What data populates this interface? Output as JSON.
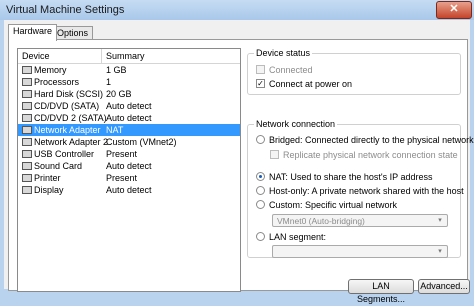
{
  "window": {
    "title": "Virtual Machine Settings",
    "close_glyph": "✕"
  },
  "tabs": [
    {
      "label": "Hardware"
    },
    {
      "label": "Options"
    }
  ],
  "device_list": {
    "col_device": "Device",
    "col_summary": "Summary",
    "rows": [
      {
        "device": "Memory",
        "summary": "1 GB"
      },
      {
        "device": "Processors",
        "summary": "1"
      },
      {
        "device": "Hard Disk (SCSI)",
        "summary": "20 GB"
      },
      {
        "device": "CD/DVD (SATA)",
        "summary": "Auto detect"
      },
      {
        "device": "CD/DVD 2 (SATA)",
        "summary": "Auto detect"
      },
      {
        "device": "Network Adapter",
        "summary": "NAT"
      },
      {
        "device": "Network Adapter 2",
        "summary": "Custom (VMnet2)"
      },
      {
        "device": "USB Controller",
        "summary": "Present"
      },
      {
        "device": "Sound Card",
        "summary": "Auto detect"
      },
      {
        "device": "Printer",
        "summary": "Present"
      },
      {
        "device": "Display",
        "summary": "Auto detect"
      }
    ]
  },
  "device_status": {
    "title": "Device status",
    "connected": "Connected",
    "connect_at_power_on": "Connect at power on"
  },
  "network_connection": {
    "title": "Network connection",
    "bridged": "Bridged: Connected directly to the physical network",
    "replicate": "Replicate physical network connection state",
    "nat": "NAT: Used to share the host's IP address",
    "host_only": "Host-only: A private network shared with the host",
    "custom": "Custom: Specific virtual network",
    "custom_value": "VMnet0 (Auto-bridging)",
    "lan_segment": "LAN segment:",
    "lan_segment_value": ""
  },
  "buttons": {
    "lan_segments": "LAN Segments...",
    "advanced": "Advanced..."
  },
  "check": "✓",
  "arrow": "▾"
}
